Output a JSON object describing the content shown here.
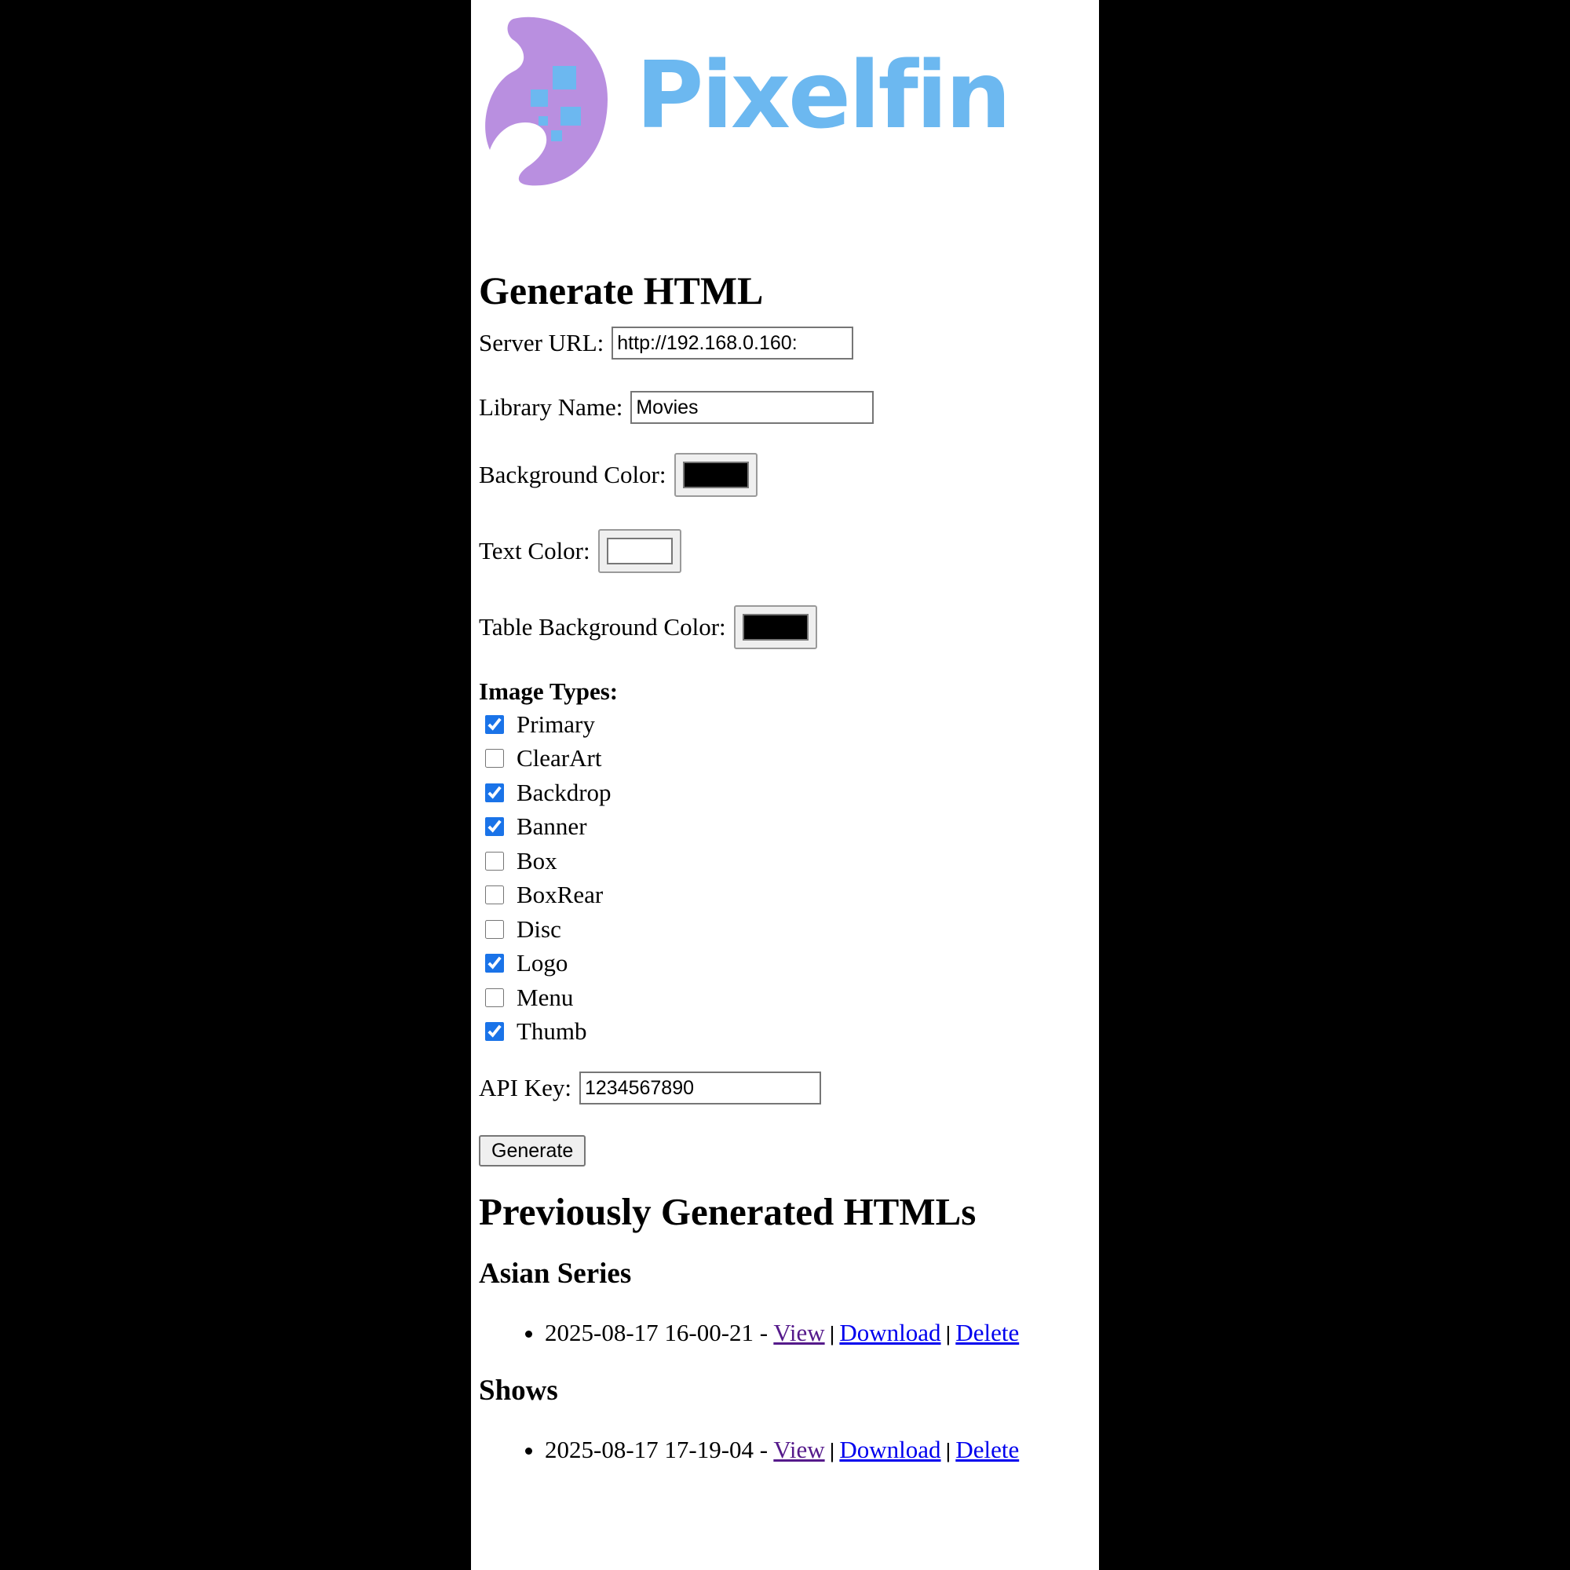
{
  "brand": {
    "name": "Pixelfin",
    "logo_icon": "fin-pixel-logo-icon",
    "logo_color": "#b98fe0",
    "brand_color": "#6cb8f0"
  },
  "form": {
    "title": "Generate HTML",
    "server_url": {
      "label": "Server URL:",
      "value": "http://192.168.0.160:"
    },
    "library_name": {
      "label": "Library Name:",
      "value": "Movies"
    },
    "background_color": {
      "label": "Background Color:",
      "value": "#000000"
    },
    "text_color": {
      "label": "Text Color:",
      "value": "#ffffff"
    },
    "table_background_color": {
      "label": "Table Background Color:",
      "value": "#000000"
    },
    "image_types": {
      "title": "Image Types:",
      "items": [
        {
          "label": "Primary",
          "checked": true
        },
        {
          "label": "ClearArt",
          "checked": false
        },
        {
          "label": "Backdrop",
          "checked": true
        },
        {
          "label": "Banner",
          "checked": true
        },
        {
          "label": "Box",
          "checked": false
        },
        {
          "label": "BoxRear",
          "checked": false
        },
        {
          "label": "Disc",
          "checked": false
        },
        {
          "label": "Logo",
          "checked": true
        },
        {
          "label": "Menu",
          "checked": false
        },
        {
          "label": "Thumb",
          "checked": true
        }
      ]
    },
    "api_key": {
      "label": "API Key:",
      "value": "1234567890"
    },
    "generate_label": "Generate"
  },
  "previous": {
    "title": "Previously Generated HTMLs",
    "groups": [
      {
        "name": "Asian Series",
        "entries": [
          {
            "timestamp": "2025-08-17 16-00-21 -",
            "view": "View",
            "download": "Download",
            "delete": "Delete"
          }
        ]
      },
      {
        "name": "Shows",
        "entries": [
          {
            "timestamp": "2025-08-17 17-19-04 -",
            "view": "View",
            "download": "Download",
            "delete": "Delete"
          }
        ]
      }
    ],
    "separator": "|"
  }
}
